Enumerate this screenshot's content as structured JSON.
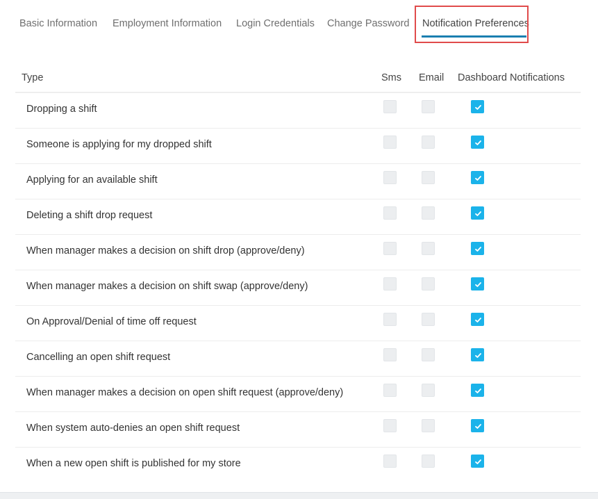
{
  "tabs": [
    {
      "label": "Basic Information",
      "active": false
    },
    {
      "label": "Employment Information",
      "active": false
    },
    {
      "label": "Login Credentials",
      "active": false
    },
    {
      "label": "Change Password",
      "active": false
    },
    {
      "label": "Notification Preferences",
      "active": true
    }
  ],
  "table": {
    "headers": {
      "type": "Type",
      "sms": "Sms",
      "email": "Email",
      "dashboard": "Dashboard Notifications"
    },
    "rows": [
      {
        "label": "Dropping a shift",
        "sms": false,
        "email": false,
        "dashboard": true
      },
      {
        "label": "Someone is applying for my dropped shift",
        "sms": false,
        "email": false,
        "dashboard": true
      },
      {
        "label": "Applying for an available shift",
        "sms": false,
        "email": false,
        "dashboard": true
      },
      {
        "label": "Deleting a shift drop request",
        "sms": false,
        "email": false,
        "dashboard": true
      },
      {
        "label": "When manager makes a decision on shift drop (approve/deny)",
        "sms": false,
        "email": false,
        "dashboard": true
      },
      {
        "label": "When manager makes a decision on shift swap (approve/deny)",
        "sms": false,
        "email": false,
        "dashboard": true
      },
      {
        "label": "On Approval/Denial of time off request",
        "sms": false,
        "email": false,
        "dashboard": true
      },
      {
        "label": "Cancelling an open shift request",
        "sms": false,
        "email": false,
        "dashboard": true
      },
      {
        "label": "When manager makes a decision on open shift request (approve/deny)",
        "sms": false,
        "email": false,
        "dashboard": true
      },
      {
        "label": "When system auto-denies an open shift request",
        "sms": false,
        "email": false,
        "dashboard": true
      },
      {
        "label": "When a new open shift is published for my store",
        "sms": false,
        "email": false,
        "dashboard": true
      }
    ]
  },
  "colors": {
    "checked": "#1bb3ea",
    "unchecked": "#eceef0",
    "active_tab_underline": "#1a7fb0",
    "highlight_box": "#e04b4b"
  },
  "icons": {
    "checked_mark": "check-icon"
  }
}
